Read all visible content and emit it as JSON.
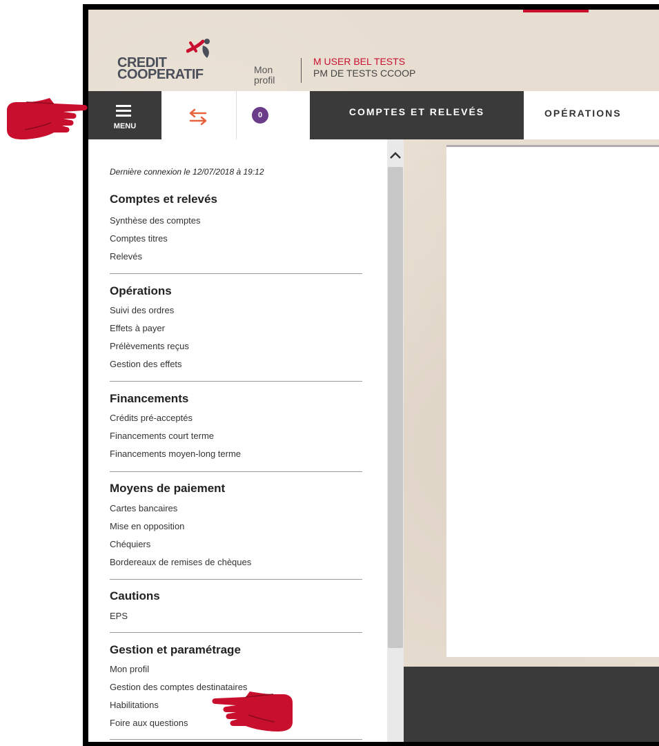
{
  "header": {
    "logo_line1": "CREDIT",
    "logo_line2": "COOPERATIF",
    "profile_link": "Mon\nprofil",
    "user_name": "M USER BEL TESTS",
    "user_company": "PM DE TESTS CCOOP"
  },
  "navbar": {
    "menu_label": "MENU",
    "badge_count": "0",
    "tab1": "COMPTES ET RELEVÉS",
    "tab2": "OPÉRATIONS"
  },
  "sidemenu": {
    "last_login": "Dernière connexion le 12/07/2018 à 19:12",
    "sections": [
      {
        "title": "Comptes et relevés",
        "items": [
          "Synthèse des comptes",
          "Comptes titres",
          "Relevés"
        ]
      },
      {
        "title": "Opérations",
        "items": [
          "Suivi des ordres",
          "Effets à payer",
          "Prélèvements reçus",
          "Gestion des effets"
        ]
      },
      {
        "title": "Financements",
        "items": [
          "Crédits pré-acceptés",
          "Financements court terme",
          "Financements moyen-long terme"
        ]
      },
      {
        "title": "Moyens de paiement",
        "items": [
          "Cartes bancaires",
          "Mise en opposition",
          "Chéquiers",
          "Bordereaux de remises de chèques"
        ]
      },
      {
        "title": "Cautions",
        "items": [
          "EPS"
        ]
      },
      {
        "title": "Gestion et paramétrage",
        "items": [
          "Mon profil",
          "Gestion des comptes destinataires",
          "Habilitations",
          "Foire aux questions"
        ]
      }
    ]
  },
  "colors": {
    "brand_red": "#c8102e",
    "nav_dark": "#3a3a3a",
    "badge_purple": "#6b3c8a",
    "swap_orange": "#e8623c"
  },
  "icons": {
    "menu": "hamburger-icon",
    "swap": "swap-arrows-icon",
    "scroll_up": "chevron-up-icon",
    "annotation": "pointing-hand-icon"
  }
}
